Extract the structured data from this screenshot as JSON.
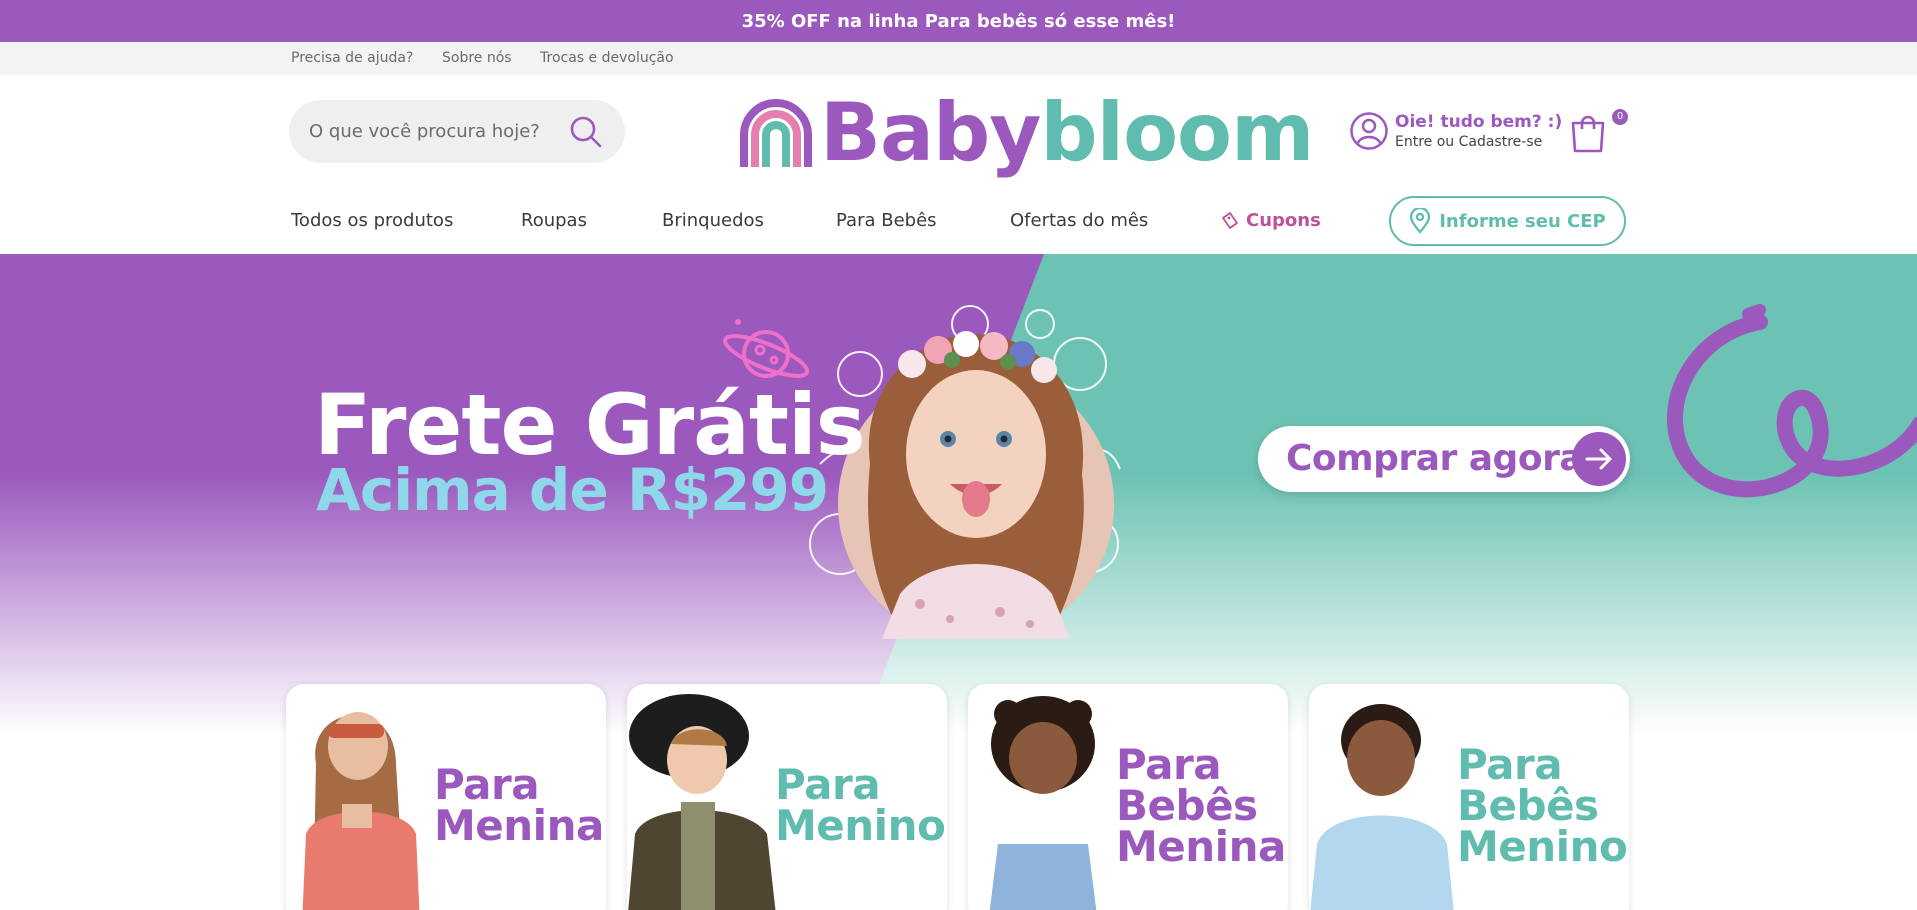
{
  "promo": {
    "text": "35% OFF na linha Para bebês só esse mês!"
  },
  "utility": {
    "links": [
      "Precisa de ajuda?",
      "Sobre nós",
      "Trocas e devolução"
    ]
  },
  "search": {
    "placeholder": "O que você procura hoje?"
  },
  "logo": {
    "part1": "Baby",
    "part2": "bloom"
  },
  "account": {
    "greeting": "Oie! tudo bem? :)",
    "subtitle": "Entre ou Cadastre-se"
  },
  "cart": {
    "count": "0"
  },
  "nav": {
    "items": [
      "Todos os produtos",
      "Roupas",
      "Brinquedos",
      "Para Bebês",
      "Ofertas do mês"
    ],
    "coupons": "Cupons",
    "cep": "Informe seu CEP"
  },
  "hero": {
    "title": "Frete Grátis",
    "subtitle": "Acima de R$299",
    "cta": "Comprar agora"
  },
  "categories": [
    {
      "line1": "Para",
      "line2": "Meninas",
      "line3": ""
    },
    {
      "line1": "Para",
      "line2": "Meninos",
      "line3": ""
    },
    {
      "line1": "Para",
      "line2": "Bebês",
      "line3": "Meninas"
    },
    {
      "line1": "Para",
      "line2": "Bebês",
      "line3": "Meninos"
    }
  ],
  "colors": {
    "brand_purple": "#9b59be",
    "brand_teal": "#5fbcae",
    "accent_pink": "#c0509a",
    "light_blue": "#8ed8ea"
  }
}
